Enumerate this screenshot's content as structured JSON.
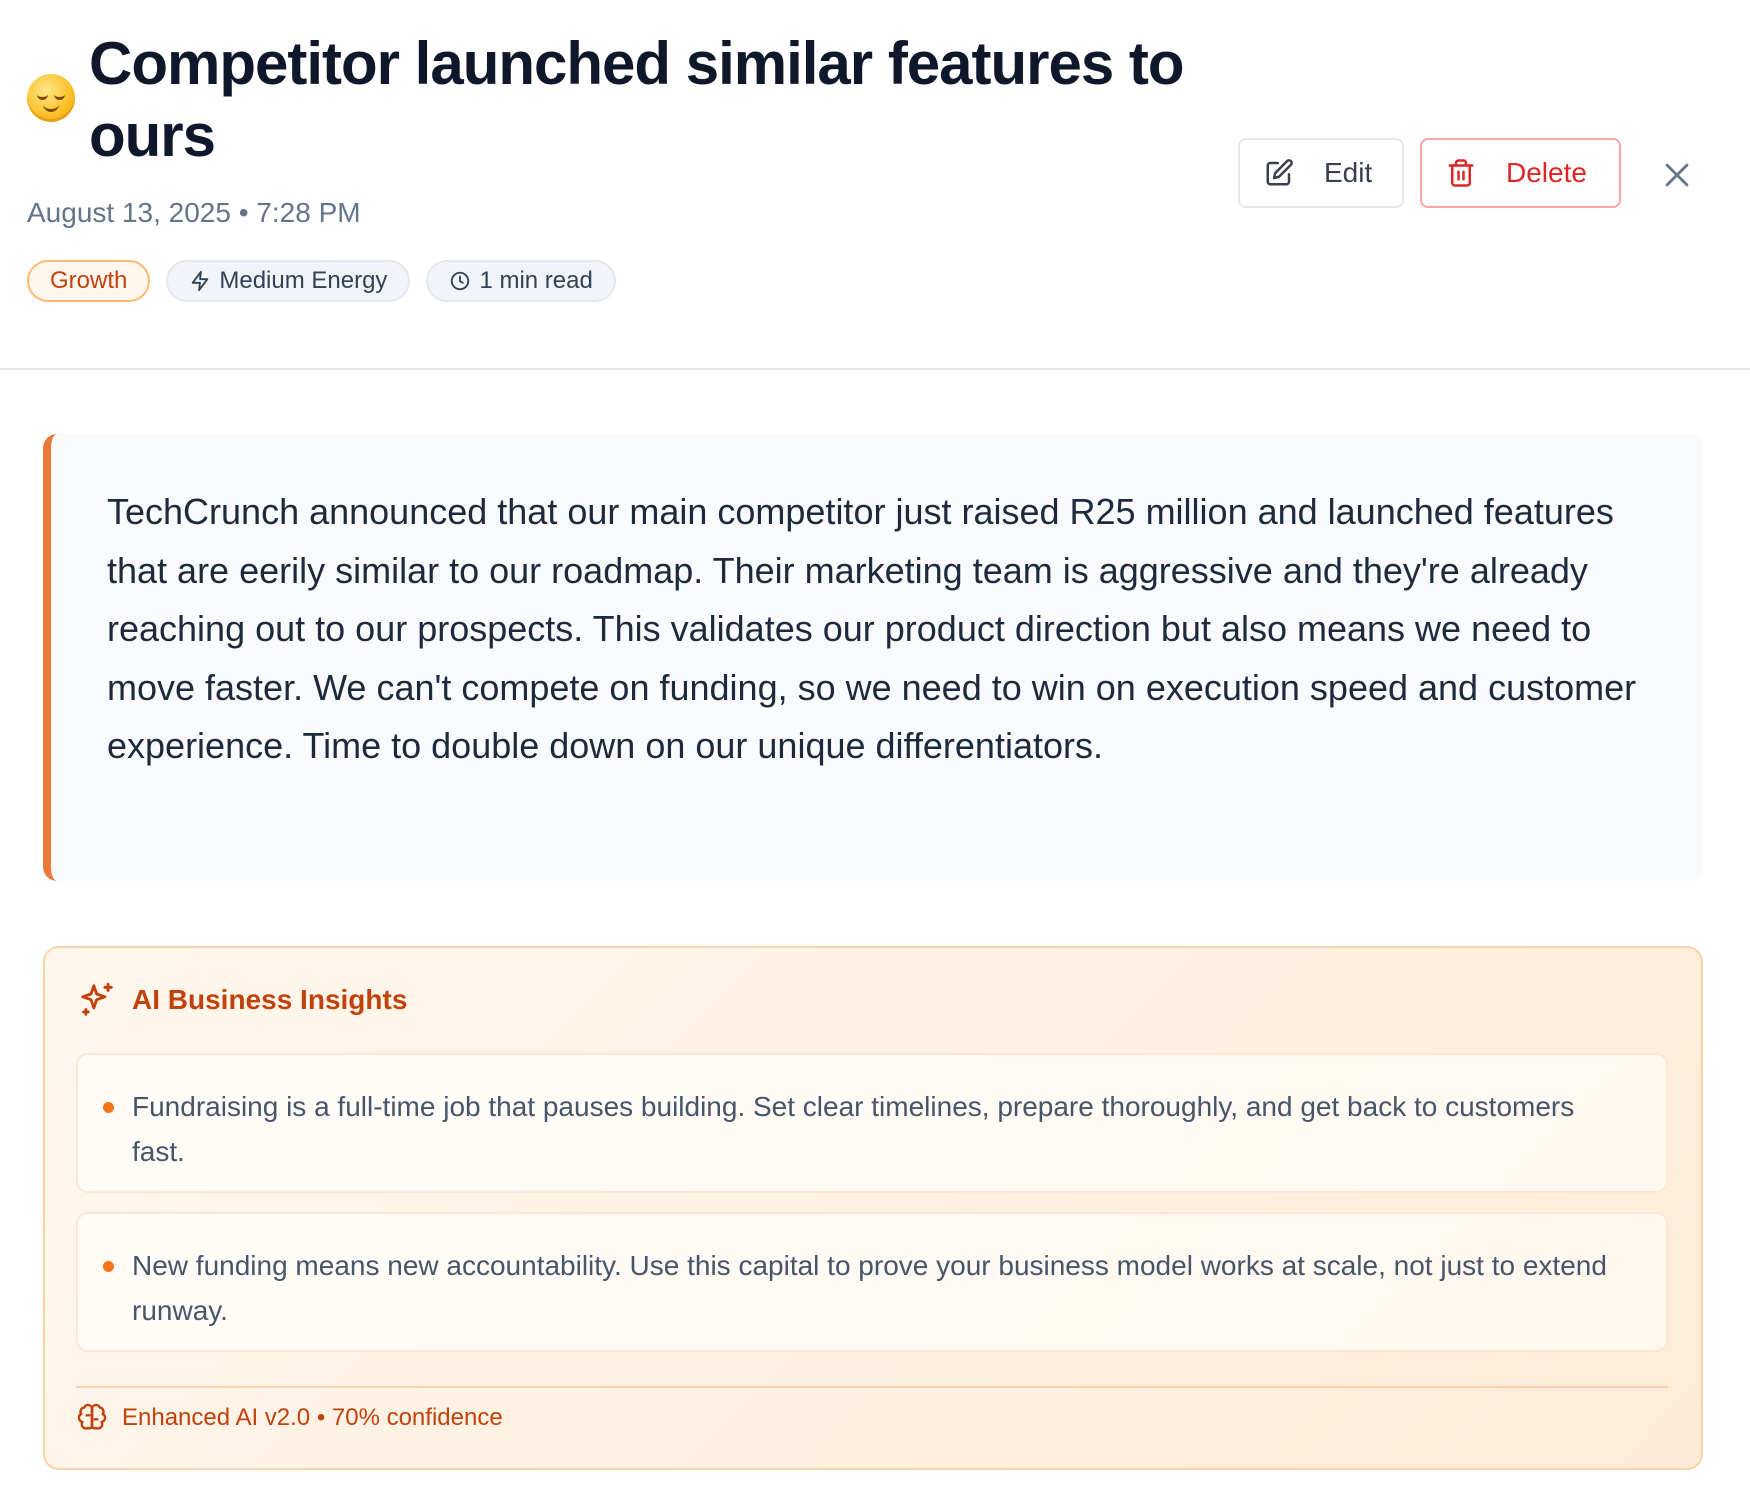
{
  "entry": {
    "mood_icon": "relieved-face-emoji",
    "title": "Competitor launched similar features to ours",
    "datetime": "August 13, 2025 • 7:28 PM",
    "tags": {
      "category": "Growth",
      "energy": "Medium Energy",
      "read_time": "1 min read"
    },
    "content": "TechCrunch announced that our main competitor just raised R25 million and launched features that are eerily similar to our roadmap. Their marketing team is aggressive and they're already reaching out to our prospects. This validates our product direction but also means we need to move faster. We can't compete on funding, so we need to win on execution speed and customer experience. Time to double down on our unique differentiators."
  },
  "actions": {
    "edit_label": "Edit",
    "delete_label": "Delete",
    "edit_icon": "edit-icon",
    "delete_icon": "trash-icon",
    "close_icon": "close-icon"
  },
  "insights": {
    "title": "AI Business Insights",
    "icon": "sparkles-icon",
    "items": [
      "Fundraising is a full-time job that pauses building. Set clear timelines, prepare thoroughly, and get back to customers fast.",
      "New funding means new accountability. Use this capital to prove your business model works at scale, not just to extend runway."
    ],
    "footer_icon": "brain-icon",
    "footer": "Enhanced AI v2.0 • 70% confidence"
  },
  "colors": {
    "accent": "#ea7a3b",
    "insight_text": "#c2410c",
    "delete": "#dc2626"
  }
}
